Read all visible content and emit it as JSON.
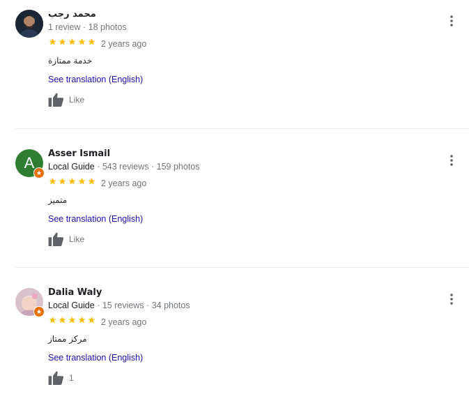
{
  "reviews": [
    {
      "name": "محمد رجب",
      "is_local_guide": false,
      "guide_label": "",
      "reviews_count": "1 review",
      "photos_count": "18 photos",
      "rating": 5,
      "date": "2 years ago",
      "text": "خدمة ممتازة",
      "translation_link": "See translation (English)",
      "like_label": "Like",
      "avatar": {
        "type": "photo",
        "letter": "",
        "bg": "#1f2a3a"
      }
    },
    {
      "name": "Asser Ismail",
      "is_local_guide": true,
      "guide_label": "Local Guide",
      "reviews_count": "543 reviews",
      "photos_count": "159 photos",
      "rating": 5,
      "date": "2 years ago",
      "text": "متميز",
      "translation_link": "See translation (English)",
      "like_label": "Like",
      "avatar": {
        "type": "letter",
        "letter": "A",
        "bg": "#2e7d32"
      }
    },
    {
      "name": "Dalia Waly",
      "is_local_guide": true,
      "guide_label": "Local Guide",
      "reviews_count": "15 reviews",
      "photos_count": "34 photos",
      "rating": 5,
      "date": "2 years ago",
      "text": "مركز ممتاز",
      "translation_link": "See translation (English)",
      "like_label": "1",
      "avatar": {
        "type": "photo",
        "letter": "",
        "bg": "#e8d5dc"
      }
    }
  ],
  "separator": " · ",
  "colors": {
    "star": "#fbbc04",
    "link": "#1a0dab",
    "meta": "#70757a",
    "guide_badge": "#e8710a",
    "divider": "#e8eaed"
  },
  "icons": {
    "star": "star-icon",
    "thumb": "thumb-up-icon",
    "menu": "more-vert-icon",
    "badge": "local-guide-badge-icon"
  }
}
